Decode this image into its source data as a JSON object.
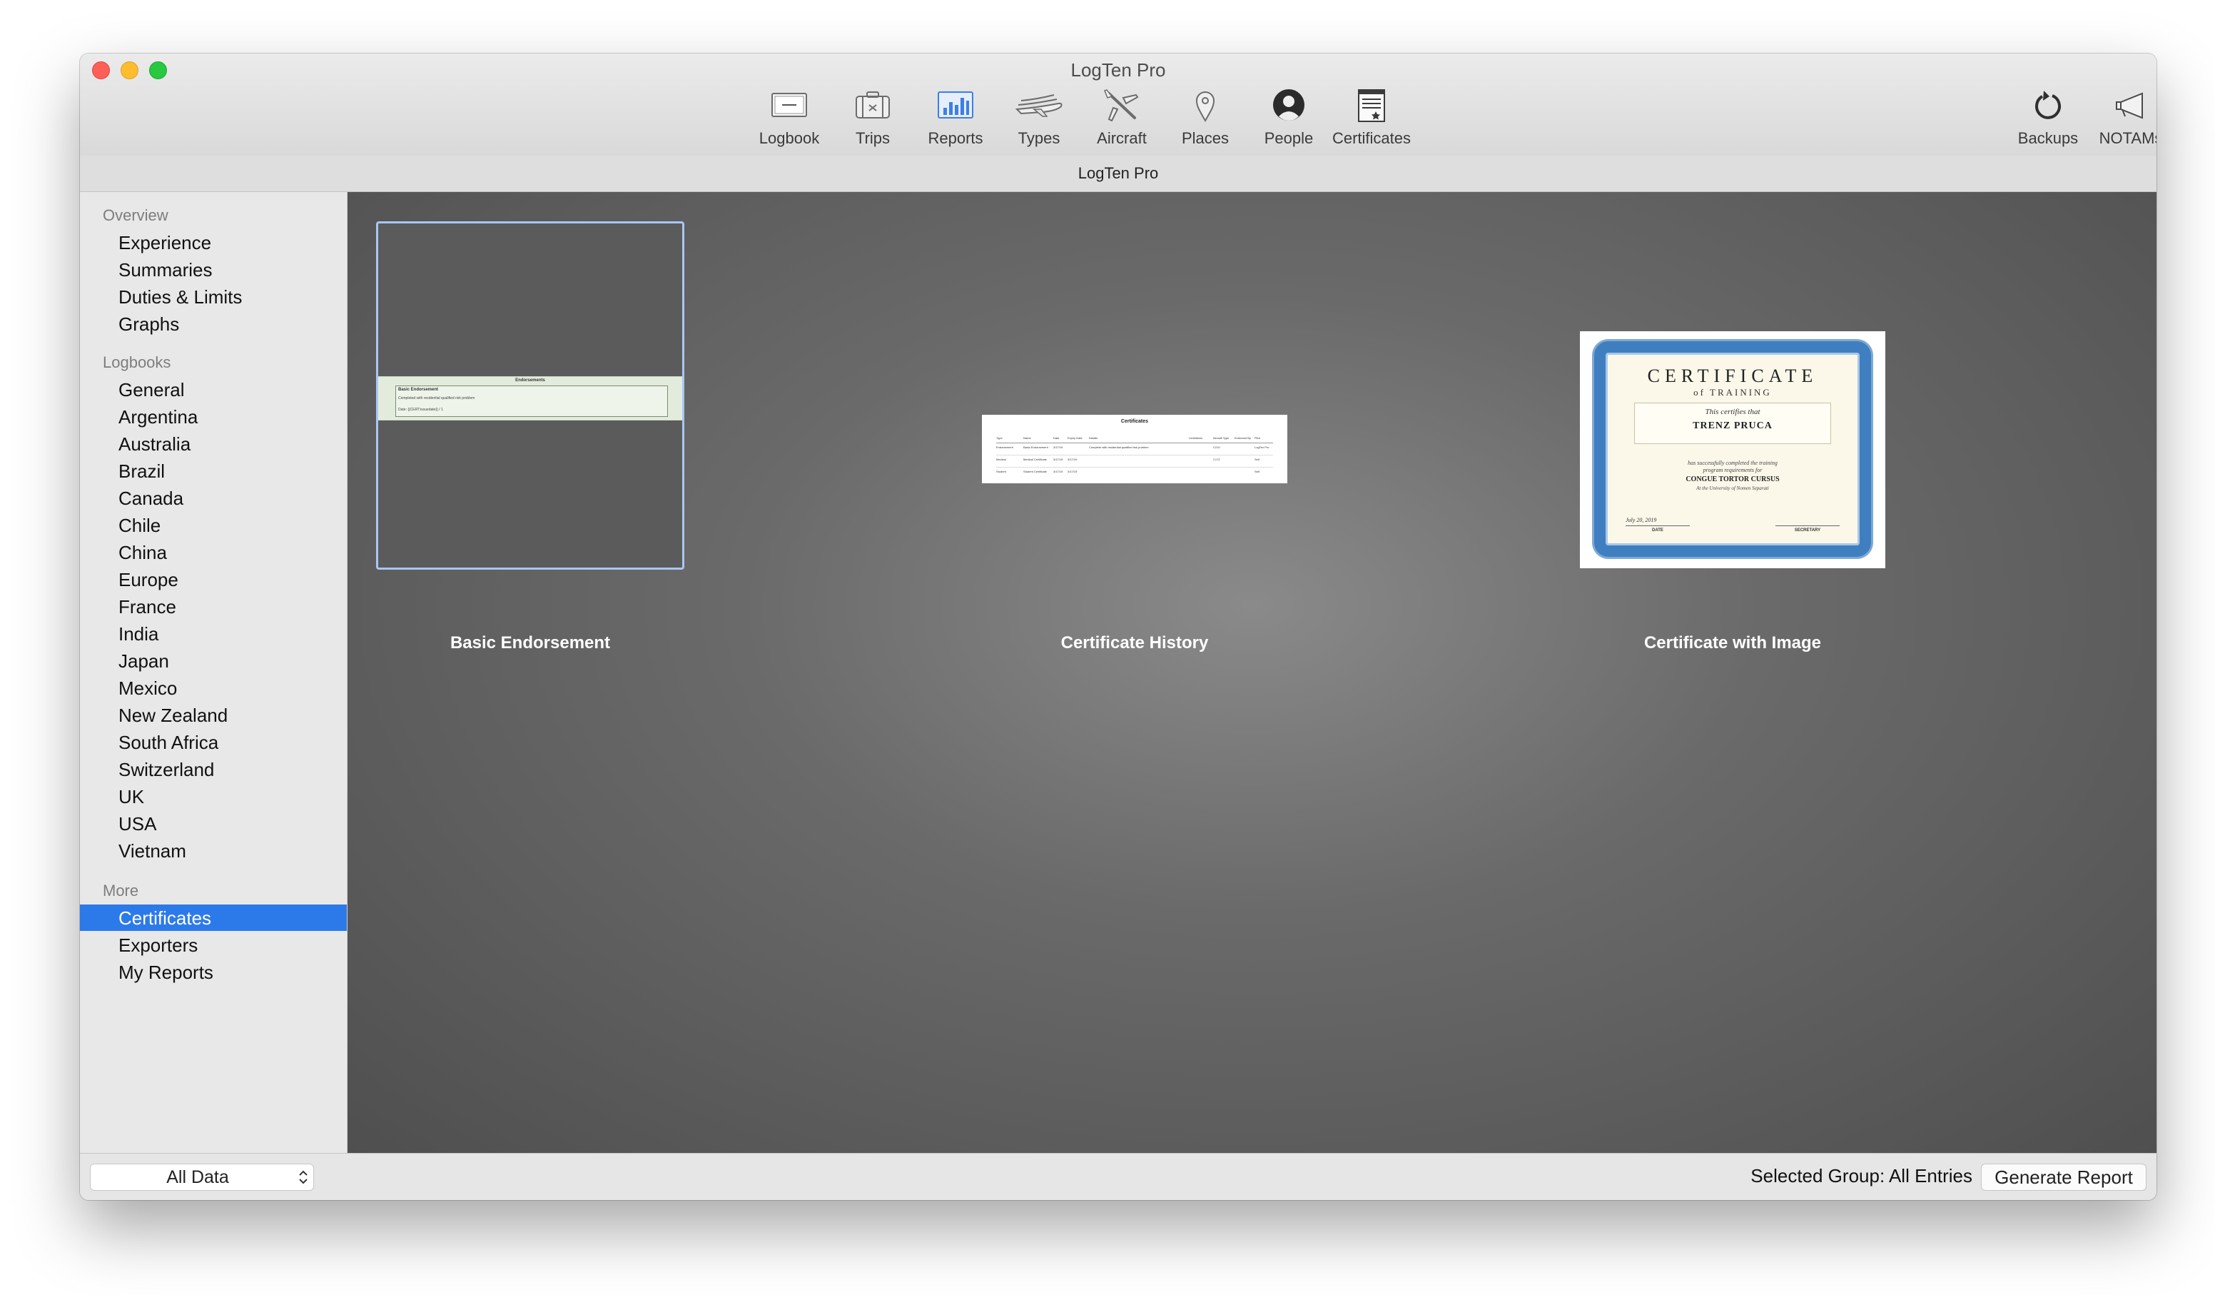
{
  "window": {
    "title": "LogTen Pro",
    "subtitle": "LogTen Pro"
  },
  "toolbar": {
    "items": [
      {
        "label": "Logbook",
        "icon": "logbook-icon"
      },
      {
        "label": "Trips",
        "icon": "suitcase-icon"
      },
      {
        "label": "Reports",
        "icon": "bar-chart-icon"
      },
      {
        "label": "Types",
        "icon": "airplane-types-icon"
      },
      {
        "label": "Aircraft",
        "icon": "airplane-icon"
      },
      {
        "label": "Places",
        "icon": "map-pin-icon"
      },
      {
        "label": "People",
        "icon": "person-icon"
      },
      {
        "label": "Certificates",
        "icon": "certificate-icon"
      }
    ],
    "right_items": [
      {
        "label": "Backups",
        "icon": "backup-icon"
      },
      {
        "label": "NOTAMs",
        "icon": "megaphone-icon"
      }
    ],
    "active": "Reports",
    "active_color": "#3d7fe6"
  },
  "sidebar": {
    "overview_header": "Overview",
    "overview": [
      "Experience",
      "Summaries",
      "Duties & Limits",
      "Graphs"
    ],
    "logbooks_header": "Logbooks",
    "logbooks": [
      "General",
      "Argentina",
      "Australia",
      "Brazil",
      "Canada",
      "Chile",
      "China",
      "Europe",
      "France",
      "India",
      "Japan",
      "Mexico",
      "New Zealand",
      "South Africa",
      "Switzerland",
      "UK",
      "USA",
      "Vietnam"
    ],
    "more_header": "More",
    "more": [
      "Certificates",
      "Exporters",
      "My Reports"
    ],
    "selected": "Certificates",
    "selected_color": "#2c7ae9"
  },
  "cards": [
    {
      "label": "Basic Endorsement",
      "selected": true
    },
    {
      "label": "Certificate History",
      "selected": false
    },
    {
      "label": "Certificate with Image",
      "selected": false
    }
  ],
  "thumb_basic": {
    "heading": "Endorsements",
    "title": "Basic Endorsement",
    "line1": "Completed with residential qualified risk problem",
    "line2": "Date: {{CERT:issuedate}} / 1"
  },
  "thumb_history": {
    "title": "Certificates",
    "headers": [
      "Type",
      "Name",
      "Date",
      "Expiry Date",
      "Details",
      "Limitations",
      "Aircraft Type",
      "Endorsed By",
      "Pilot"
    ],
    "rows": [
      [
        "Endorsement",
        "Basic Endorsement",
        "3/17/19",
        "",
        "Complete with residential qualified risk problem",
        "",
        "C210",
        "",
        "LogTen Pro"
      ],
      [
        "Medical",
        "Medical Certificate",
        "3/17/19",
        "3/17/19",
        "",
        "",
        "C172",
        "",
        "Self"
      ],
      [
        "Student",
        "Student Certificate",
        "3/17/19",
        "3/17/19",
        "",
        "",
        "",
        "",
        "Self"
      ]
    ]
  },
  "thumb_image": {
    "heading": "CERTIFICATE",
    "sub": "of TRAINING",
    "certifies": "This certifies that",
    "name": "TRENZ PRUCA",
    "completed": "has successfully completed the training",
    "program": "program requirements for",
    "course": "CONGUE TORTOR CURSUS",
    "place": "At the University of Nomen Separati",
    "date_value": "July 20, 2019",
    "date_label": "DATE",
    "secretary_label": "SECRETARY"
  },
  "footer": {
    "filter": "All Data",
    "selected_group": "Selected Group: All Entries",
    "generate": "Generate Report"
  }
}
